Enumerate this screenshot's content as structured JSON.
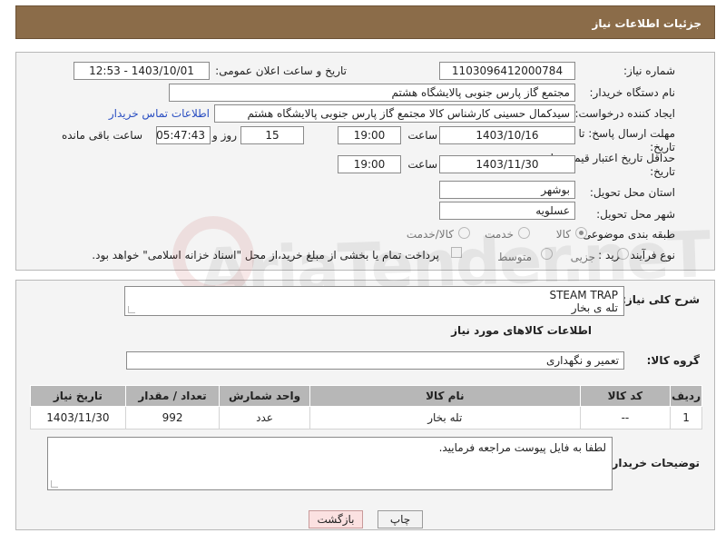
{
  "header": {
    "title": "جزئیات اطلاعات نیاز"
  },
  "form": {
    "need_number": {
      "label": "شماره نیاز:",
      "value": "1103096412000784"
    },
    "announce_datetime": {
      "label": "تاریخ و ساعت اعلان عمومی:",
      "value": "1403/10/01 - 12:53"
    },
    "buyer_org": {
      "label": "نام دستگاه خریدار:",
      "value": "مجتمع گاز پارس جنوبی  پالایشگاه هشتم"
    },
    "requester": {
      "label": "ایجاد کننده درخواست:",
      "value": "سیدکمال حسینی کارشناس کالا مجتمع گاز پارس جنوبی  پالایشگاه هشتم",
      "contact_link": "اطلاعات تماس خریدار"
    },
    "reply_deadline": {
      "label_line1": "مهلت ارسال پاسخ: تا",
      "label_line2": "تاریخ:",
      "date": "1403/10/16",
      "time_label": "ساعت",
      "time": "19:00",
      "days": "15",
      "days_label": "روز و",
      "remaining": "05:47:43",
      "remaining_label": "ساعت باقی مانده"
    },
    "price_validity": {
      "label_line1": "حداقل تاریخ اعتبار قیمت: تا",
      "label_line2": "تاریخ:",
      "date": "1403/11/30",
      "time_label": "ساعت",
      "time": "19:00"
    },
    "delivery_province": {
      "label": "استان محل تحویل:",
      "value": "بوشهر"
    },
    "delivery_city": {
      "label": "شهر محل تحویل:",
      "value": "عسلویه"
    },
    "category": {
      "label": "طبقه بندی موضوعی:",
      "options": [
        "کالا",
        "خدمت",
        "کالا/خدمت"
      ],
      "selected": "کالا"
    },
    "purchase_type": {
      "label": "نوع فرآیند خرید :",
      "options": [
        "جزیی",
        "متوسط"
      ],
      "selected": "",
      "payment_note": "پرداخت تمام یا بخشی از مبلغ خرید،از محل \"اسناد خزانه اسلامی\" خواهد بود."
    }
  },
  "description": {
    "label": "شرح کلی نیاز:",
    "text_line1": "STEAM TRAP",
    "text_line2": "تله ی بخار"
  },
  "goods_info": {
    "title": "اطلاعات کالاهای مورد نیاز",
    "group_label": "گروه کالا:",
    "group_value": "تعمیر و نگهداری"
  },
  "table": {
    "headers": [
      "ردیف",
      "کد کالا",
      "نام کالا",
      "واحد شمارش",
      "تعداد / مقدار",
      "تاریخ نیاز"
    ],
    "rows": [
      [
        "1",
        "--",
        "تله بخار",
        "عدد",
        "992",
        "1403/11/30"
      ]
    ]
  },
  "buyer_notes": {
    "label": "توضیحات خریدار:",
    "text": "لطفا به فایل پیوست مراجعه فرمایید."
  },
  "buttons": {
    "print": "چاپ",
    "back": "بازگشت"
  },
  "watermark": "AriaTender.neT",
  "colors": {
    "header_bg": "#8b6c49",
    "table_header_bg": "#b7b7b7",
    "link": "#2b4fc2",
    "back_button_bg": "#fbe1e1"
  }
}
